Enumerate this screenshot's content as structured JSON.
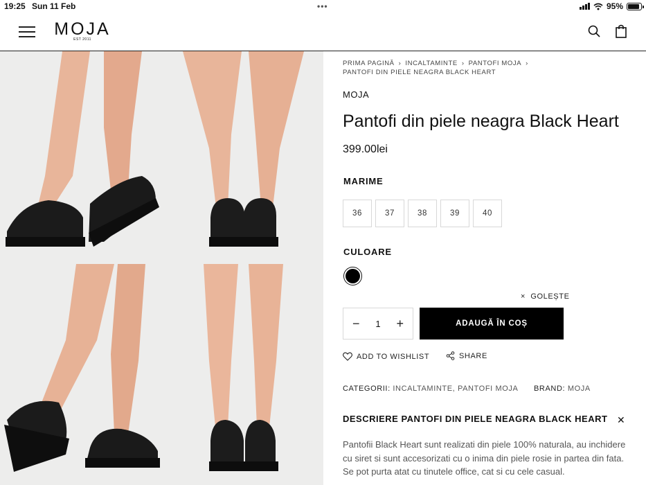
{
  "status_bar": {
    "time": "19:25",
    "date": "Sun 11 Feb",
    "battery": "95%",
    "battery_level": 0.95
  },
  "header": {
    "logo": "MOJA",
    "logo_tagline": "EST 2011",
    "menu_icon": "hamburger-icon",
    "search_icon": "search-icon",
    "cart_icon": "shopping-bag-icon"
  },
  "gallery": {
    "photos": [
      "shoes-side-view",
      "shoes-front-view",
      "shoes-side-view-2",
      "shoes-back-view"
    ],
    "background": "#ededec"
  },
  "breadcrumb": {
    "items": [
      "PRIMA PAGINĂ",
      "INCALTAMINTE",
      "PANTOFI MOJA",
      "PANTOFI DIN PIELE NEAGRA BLACK HEART"
    ]
  },
  "product": {
    "brand": "MOJA",
    "title": "Pantofi din piele neagra Black Heart",
    "price": "399.00lei",
    "size_label": "MARIME",
    "sizes": [
      "36",
      "37",
      "38",
      "39",
      "40"
    ],
    "color_label": "CULOARE",
    "color_value": "#000000",
    "clear_label": "GOLEȘTE",
    "quantity": "1",
    "add_to_cart": "ADAUGĂ ÎN COȘ",
    "wishlist": "ADD TO WISHLIST",
    "share": "SHARE",
    "categories_label": "CATEGORII:",
    "categories": "INCALTAMINTE, PANTOFI MOJA",
    "brand_label": "BRAND:",
    "brand_value": "MOJA"
  },
  "description": {
    "heading": "DESCRIERE PANTOFI DIN PIELE NEAGRA BLACK HEART",
    "text": "Pantofii Black Heart sunt realizati din piele 100% naturala, au inchidere cu siret si sunt accesorizati cu o inima din piele rosie in partea din fata. Se pot purta atat cu tinutele office, cat si cu cele casual."
  }
}
